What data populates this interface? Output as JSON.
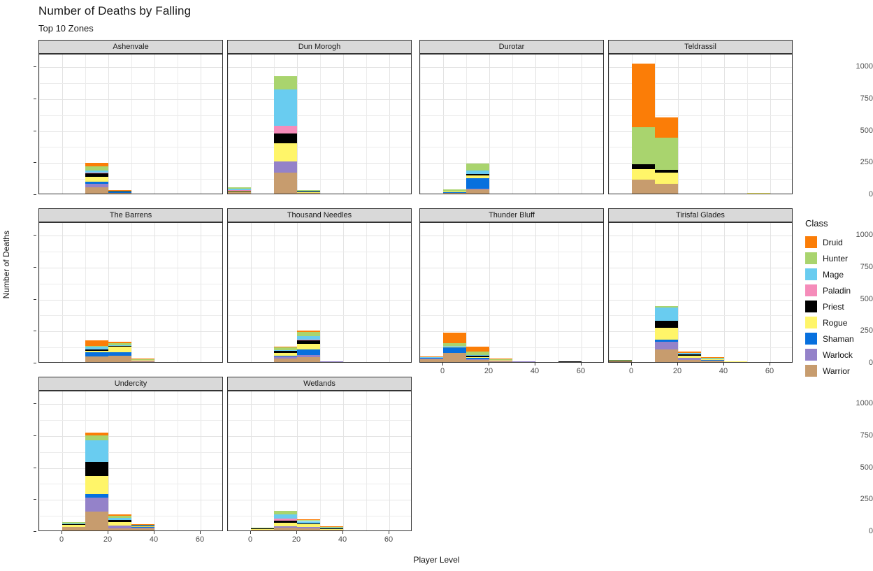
{
  "header": {
    "title": "Number of Deaths by Falling",
    "subtitle": "Top 10 Zones"
  },
  "axes": {
    "x_title": "Player Level",
    "y_title": "Number of Deaths",
    "y_ticks": [
      "0",
      "250",
      "500",
      "750",
      "1000"
    ],
    "x_ticks": [
      "0",
      "20",
      "40",
      "60"
    ]
  },
  "legend": {
    "title": "Class",
    "items": [
      {
        "label": "Druid",
        "color": "#fb7d07"
      },
      {
        "label": "Hunter",
        "color": "#a9d46e"
      },
      {
        "label": "Mage",
        "color": "#69ccf0"
      },
      {
        "label": "Paladin",
        "color": "#f58cba"
      },
      {
        "label": "Priest",
        "color": "#000000"
      },
      {
        "label": "Rogue",
        "color": "#fff569"
      },
      {
        "label": "Shaman",
        "color": "#0770de"
      },
      {
        "label": "Warlock",
        "color": "#9482c9"
      },
      {
        "label": "Warrior",
        "color": "#c79c6e"
      }
    ]
  },
  "chart_data": {
    "type": "bar",
    "stacked": true,
    "facet": true,
    "title": "Number of Deaths by Falling",
    "subtitle": "Top 10 Zones",
    "xlabel": "Player Level",
    "ylabel": "Number of Deaths",
    "xlim": [
      -10,
      70
    ],
    "ylim": [
      0,
      1100
    ],
    "y_ticks": [
      0,
      250,
      500,
      750,
      1000
    ],
    "x_ticks": [
      0,
      20,
      40,
      60
    ],
    "bin_width": 10,
    "grid": true,
    "legend_position": "right",
    "legend_title": "Class",
    "series_order": [
      "Druid",
      "Hunter",
      "Mage",
      "Paladin",
      "Priest",
      "Rogue",
      "Shaman",
      "Warlock",
      "Warrior"
    ],
    "colors": {
      "Druid": "#fb7d07",
      "Hunter": "#a9d46e",
      "Mage": "#69ccf0",
      "Paladin": "#f58cba",
      "Priest": "#000000",
      "Rogue": "#fff569",
      "Shaman": "#0770de",
      "Warlock": "#9482c9",
      "Warrior": "#c79c6e"
    },
    "panels": [
      {
        "name": "Ashenvale",
        "bars": [
          {
            "x": 10,
            "values": {
              "Warrior": 52,
              "Warlock": 26,
              "Shaman": 14,
              "Rogue": 38,
              "Priest": 29,
              "Paladin": 8,
              "Mage": 12,
              "Hunter": 37,
              "Druid": 23
            }
          },
          {
            "x": 20,
            "values": {
              "Warrior": 6,
              "Warlock": 2,
              "Shaman": 3,
              "Rogue": 2,
              "Priest": 3,
              "Paladin": 1,
              "Mage": 3,
              "Hunter": 3,
              "Druid": 7
            }
          }
        ]
      },
      {
        "name": "Dun Morogh",
        "bars": [
          {
            "x": -10,
            "values": {
              "Warrior": 10,
              "Warlock": 2,
              "Shaman": 0,
              "Rogue": 6,
              "Priest": 3,
              "Paladin": 4,
              "Mage": 14,
              "Hunter": 12,
              "Druid": 0
            }
          },
          {
            "x": 10,
            "values": {
              "Warrior": 162,
              "Warlock": 88,
              "Shaman": 0,
              "Rogue": 146,
              "Priest": 74,
              "Paladin": 60,
              "Mage": 286,
              "Hunter": 104,
              "Druid": 0
            }
          },
          {
            "x": 20,
            "values": {
              "Warrior": 6,
              "Warlock": 2,
              "Shaman": 0,
              "Rogue": 3,
              "Priest": 3,
              "Paladin": 2,
              "Mage": 5,
              "Hunter": 2,
              "Druid": 0
            }
          }
        ]
      },
      {
        "name": "Durotar",
        "bars": [
          {
            "x": 0,
            "values": {
              "Warrior": 4,
              "Warlock": 2,
              "Shaman": 3,
              "Rogue": 5,
              "Priest": 2,
              "Paladin": 0,
              "Mage": 2,
              "Hunter": 14,
              "Druid": 0
            }
          },
          {
            "x": 10,
            "values": {
              "Warrior": 32,
              "Warlock": 7,
              "Shaman": 84,
              "Rogue": 20,
              "Priest": 13,
              "Paladin": 0,
              "Mage": 22,
              "Hunter": 56,
              "Druid": 0
            }
          }
        ]
      },
      {
        "name": "Teldrassil",
        "bars": [
          {
            "x": 0,
            "values": {
              "Warrior": 108,
              "Warlock": 0,
              "Shaman": 0,
              "Rogue": 86,
              "Priest": 34,
              "Paladin": 0,
              "Mage": 0,
              "Hunter": 290,
              "Druid": 502
            }
          },
          {
            "x": 10,
            "values": {
              "Warrior": 74,
              "Warlock": 0,
              "Shaman": 0,
              "Rogue": 88,
              "Priest": 26,
              "Paladin": 0,
              "Mage": 0,
              "Hunter": 248,
              "Druid": 160
            }
          },
          {
            "x": 50,
            "values": {
              "Warrior": 0,
              "Warlock": 0,
              "Shaman": 0,
              "Rogue": 6,
              "Priest": 0,
              "Paladin": 0,
              "Mage": 0,
              "Hunter": 0,
              "Druid": 0
            }
          }
        ]
      },
      {
        "name": "The Barrens",
        "bars": [
          {
            "x": 10,
            "values": {
              "Warrior": 42,
              "Warlock": 4,
              "Shaman": 32,
              "Rogue": 12,
              "Priest": 11,
              "Paladin": 0,
              "Mage": 17,
              "Hunter": 10,
              "Druid": 40
            }
          },
          {
            "x": 20,
            "values": {
              "Warrior": 48,
              "Warlock": 4,
              "Shaman": 24,
              "Rogue": 44,
              "Priest": 4,
              "Paladin": 0,
              "Mage": 5,
              "Hunter": 20,
              "Druid": 10
            }
          },
          {
            "x": 30,
            "values": {
              "Warrior": 8,
              "Warlock": 1,
              "Shaman": 2,
              "Rogue": 3,
              "Priest": 4,
              "Paladin": 0,
              "Mage": 1,
              "Hunter": 1,
              "Druid": 1
            }
          }
        ]
      },
      {
        "name": "Thousand Needles",
        "bars": [
          {
            "x": 10,
            "values": {
              "Warrior": 30,
              "Warlock": 12,
              "Shaman": 10,
              "Rogue": 17,
              "Priest": 16,
              "Paladin": 0,
              "Mage": 10,
              "Hunter": 20,
              "Druid": 6
            }
          },
          {
            "x": 20,
            "values": {
              "Warrior": 40,
              "Warlock": 14,
              "Shaman": 44,
              "Rogue": 46,
              "Priest": 28,
              "Paladin": 4,
              "Mage": 26,
              "Hunter": 32,
              "Druid": 12
            }
          },
          {
            "x": 30,
            "values": {
              "Warrior": 0,
              "Warlock": 5,
              "Shaman": 0,
              "Rogue": 0,
              "Priest": 0,
              "Paladin": 0,
              "Mage": 0,
              "Hunter": 0,
              "Druid": 0
            }
          }
        ]
      },
      {
        "name": "Thunder Bluff",
        "bars": [
          {
            "x": -10,
            "values": {
              "Warrior": 24,
              "Warlock": 2,
              "Shaman": 5,
              "Rogue": 2,
              "Priest": 1,
              "Paladin": 0,
              "Mage": 2,
              "Hunter": 2,
              "Druid": 6
            }
          },
          {
            "x": 0,
            "values": {
              "Warrior": 70,
              "Warlock": 3,
              "Shaman": 43,
              "Rogue": 4,
              "Priest": 2,
              "Paladin": 0,
              "Mage": 6,
              "Hunter": 20,
              "Druid": 80
            }
          },
          {
            "x": 10,
            "values": {
              "Warrior": 18,
              "Warlock": 6,
              "Shaman": 10,
              "Rogue": 6,
              "Priest": 8,
              "Paladin": 0,
              "Mage": 8,
              "Hunter": 24,
              "Druid": 42
            }
          },
          {
            "x": 20,
            "values": {
              "Warrior": 8,
              "Warlock": 2,
              "Shaman": 2,
              "Rogue": 4,
              "Priest": 1,
              "Paladin": 0,
              "Mage": 2,
              "Hunter": 2,
              "Druid": 2
            }
          },
          {
            "x": 30,
            "values": {
              "Warrior": 0,
              "Warlock": 4,
              "Shaman": 0,
              "Rogue": 0,
              "Priest": 0,
              "Paladin": 0,
              "Mage": 0,
              "Hunter": 0,
              "Druid": 0
            }
          },
          {
            "x": 50,
            "values": {
              "Warrior": 0,
              "Warlock": 0,
              "Shaman": 0,
              "Rogue": 0,
              "Priest": 5,
              "Paladin": 0,
              "Mage": 0,
              "Hunter": 0,
              "Druid": 0
            }
          }
        ]
      },
      {
        "name": "Tirisfal Glades",
        "bars": [
          {
            "x": -10,
            "values": {
              "Warrior": 4,
              "Warlock": 2,
              "Shaman": 0,
              "Rogue": 2,
              "Priest": 2,
              "Paladin": 0,
              "Mage": 2,
              "Hunter": 3,
              "Druid": 0
            }
          },
          {
            "x": 10,
            "values": {
              "Warrior": 96,
              "Warlock": 62,
              "Shaman": 16,
              "Rogue": 96,
              "Priest": 52,
              "Paladin": 0,
              "Mage": 104,
              "Hunter": 12,
              "Druid": 0
            }
          },
          {
            "x": 20,
            "values": {
              "Warrior": 18,
              "Warlock": 14,
              "Shaman": 3,
              "Rogue": 16,
              "Priest": 10,
              "Paladin": 0,
              "Mage": 8,
              "Hunter": 4,
              "Druid": 6
            }
          },
          {
            "x": 30,
            "values": {
              "Warrior": 10,
              "Warlock": 3,
              "Shaman": 2,
              "Rogue": 6,
              "Priest": 3,
              "Paladin": 0,
              "Mage": 3,
              "Hunter": 4,
              "Druid": 2
            }
          },
          {
            "x": 40,
            "values": {
              "Warrior": 0,
              "Warlock": 0,
              "Shaman": 0,
              "Rogue": 4,
              "Priest": 0,
              "Paladin": 0,
              "Mage": 0,
              "Hunter": 0,
              "Druid": 0
            }
          }
        ]
      },
      {
        "name": "Undercity",
        "bars": [
          {
            "x": 0,
            "values": {
              "Warrior": 26,
              "Warlock": 4,
              "Shaman": 0,
              "Rogue": 14,
              "Priest": 4,
              "Paladin": 0,
              "Mage": 6,
              "Hunter": 10,
              "Druid": 0
            }
          },
          {
            "x": 10,
            "values": {
              "Warrior": 150,
              "Warlock": 110,
              "Shaman": 22,
              "Rogue": 146,
              "Priest": 108,
              "Paladin": 0,
              "Mage": 172,
              "Hunter": 36,
              "Druid": 20
            }
          },
          {
            "x": 20,
            "values": {
              "Warrior": 14,
              "Warlock": 22,
              "Shaman": 4,
              "Rogue": 28,
              "Priest": 16,
              "Paladin": 0,
              "Mage": 16,
              "Hunter": 14,
              "Druid": 10
            }
          },
          {
            "x": 30,
            "values": {
              "Warrior": 16,
              "Warlock": 8,
              "Shaman": 2,
              "Rogue": 8,
              "Priest": 5,
              "Paladin": 0,
              "Mage": 3,
              "Hunter": 3,
              "Druid": 6
            }
          }
        ]
      },
      {
        "name": "Wetlands",
        "bars": [
          {
            "x": 0,
            "values": {
              "Warrior": 4,
              "Warlock": 2,
              "Shaman": 0,
              "Rogue": 6,
              "Priest": 2,
              "Paladin": 1,
              "Mage": 2,
              "Hunter": 6,
              "Druid": 0
            }
          },
          {
            "x": 10,
            "values": {
              "Warrior": 20,
              "Warlock": 14,
              "Shaman": 0,
              "Rogue": 28,
              "Priest": 16,
              "Paladin": 14,
              "Mage": 36,
              "Hunter": 24,
              "Druid": 0
            }
          },
          {
            "x": 20,
            "values": {
              "Warrior": 14,
              "Warlock": 12,
              "Shaman": 0,
              "Rogue": 22,
              "Priest": 6,
              "Paladin": 2,
              "Mage": 18,
              "Hunter": 8,
              "Druid": 6
            }
          },
          {
            "x": 30,
            "values": {
              "Warrior": 5,
              "Warlock": 3,
              "Shaman": 0,
              "Rogue": 5,
              "Priest": 2,
              "Paladin": 1,
              "Mage": 8,
              "Hunter": 2,
              "Druid": 2
            }
          }
        ]
      }
    ]
  },
  "layout": {
    "panel_grid": [
      [
        "Ashenvale",
        "Dun Morogh",
        "Durotar",
        "Teldrassil"
      ],
      [
        "The Barrens",
        "Thousand Needles",
        "Thunder Bluff",
        "Tirisfal Glades"
      ],
      [
        "Undercity",
        "Wetlands",
        null,
        null
      ]
    ]
  }
}
